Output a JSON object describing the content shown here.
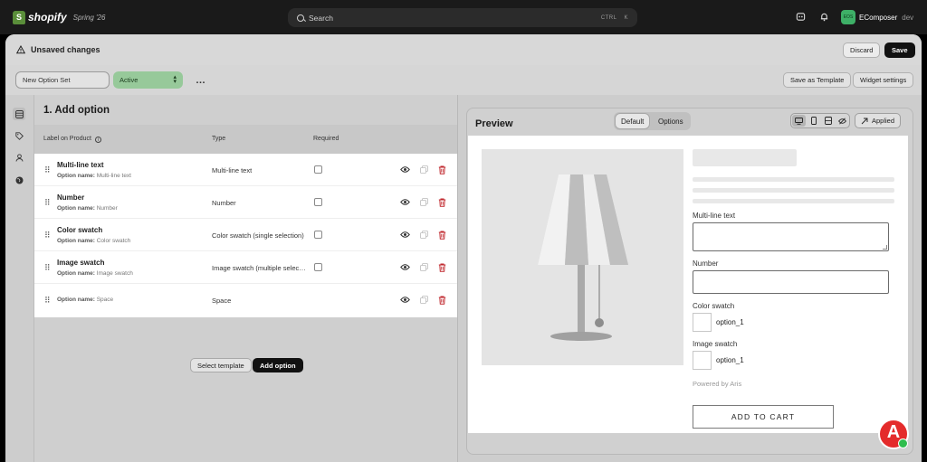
{
  "topbar": {
    "brand": "shopify",
    "brand_mark": "S",
    "season": "Spring '26",
    "search_placeholder": "Search",
    "kbd_ctrl": "CTRL",
    "kbd_k": "K",
    "store_avatar": "EOS",
    "store_name": "EComposer",
    "store_env": "dev"
  },
  "save_bar": {
    "message": "Unsaved changes",
    "discard_label": "Discard",
    "save_label": "Save"
  },
  "toolbar": {
    "option_set_name": "New Option Set",
    "status": "Active",
    "more": "…",
    "save_template_label": "Save as Template",
    "widget_settings_label": "Widget settings"
  },
  "rail": {
    "items": [
      "options-icon",
      "tag-icon",
      "person-icon",
      "globe-icon"
    ]
  },
  "options_panel": {
    "title": "1. Add option",
    "columns": {
      "label": "Label on Product",
      "type": "Type",
      "required": "Required"
    },
    "name_prefix": "Option name:",
    "rows": [
      {
        "label": "Multi-line text",
        "name": "Multi-line text",
        "type": "Multi-line text"
      },
      {
        "label": "Number",
        "name": "Number",
        "type": "Number"
      },
      {
        "label": "Color swatch",
        "name": "Color swatch",
        "type": "Color swatch (single selection)"
      },
      {
        "label": "Image swatch",
        "name": "Image swatch",
        "type": "Image swatch (multiple selection)"
      },
      {
        "label": "",
        "name": "Space",
        "type": "Space"
      }
    ],
    "select_template_label": "Select template",
    "add_option_label": "Add option"
  },
  "preview": {
    "title": "Preview",
    "tab_default": "Default",
    "tab_options": "Options",
    "applied_label": "Applied",
    "fields": {
      "multiline_label": "Multi-line text",
      "number_label": "Number",
      "color_label": "Color swatch",
      "color_option": "option_1",
      "image_label": "Image swatch",
      "image_option": "option_1"
    },
    "powered_by": "Powered by Aris",
    "add_to_cart": "ADD TO CART"
  },
  "aris_badge": "A",
  "colors": {
    "topbar": "#1a1a1a",
    "active_status": "#97c99a",
    "delete_icon": "#c0272d",
    "aris_red": "#e42b2b",
    "online_green": "#2fbd4d"
  }
}
